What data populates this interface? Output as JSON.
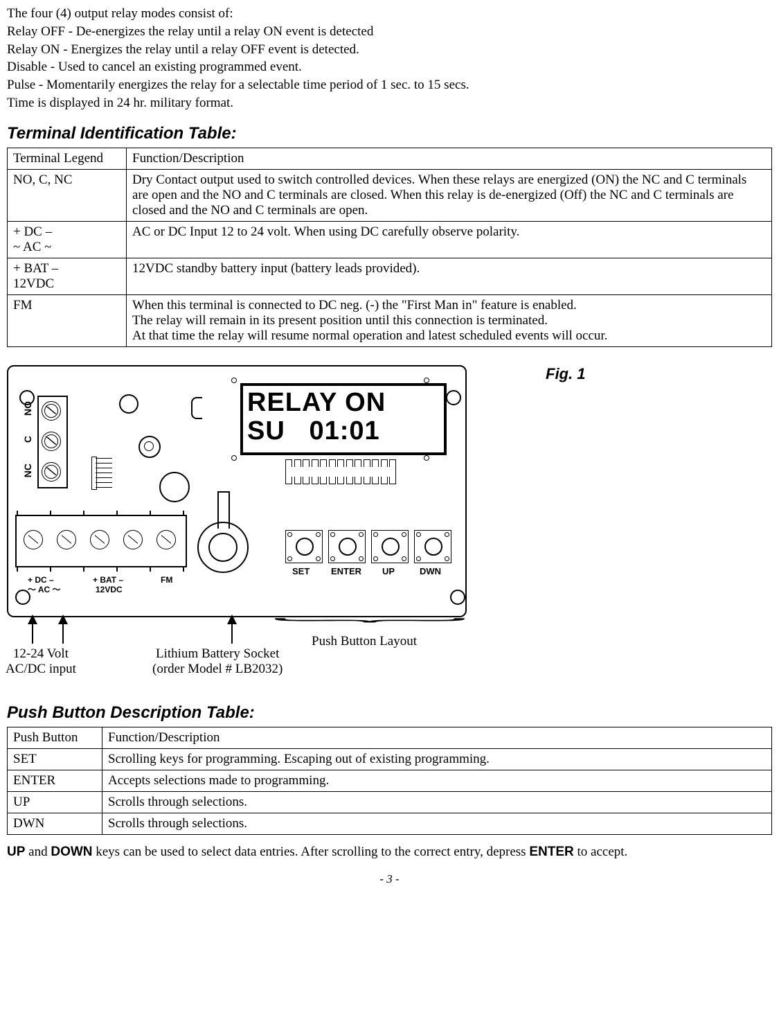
{
  "intro": {
    "line1": "The four (4) output relay modes consist of:",
    "line2": "Relay OFF - De-energizes the relay until a relay ON event is detected",
    "line3": "Relay ON - Energizes the relay until a relay OFF event is detected.",
    "line4": "Disable - Used to cancel an existing programmed event.",
    "line5": "Pulse - Momentarily energizes the relay for a selectable time period of 1 sec. to 15 secs.",
    "line6": "Time is displayed in 24 hr. military format."
  },
  "terminal_table": {
    "title": "Terminal Identification Table:",
    "header": {
      "c1": "Terminal Legend",
      "c2": "Function/Description"
    },
    "rows": [
      {
        "c1": "NO, C, NC",
        "c2": "Dry Contact output used to switch controlled devices. When these relays are energized (ON) the NC and C terminals are open and the NO and C terminals are closed. When this relay is de-energized (Off) the NC and C terminals are closed and the NO and C terminals are open."
      },
      {
        "c1": "+ DC –\n~ AC ~",
        "c2": "AC or DC Input 12 to 24 volt. When using DC carefully observe polarity."
      },
      {
        "c1": "+ BAT –\n12VDC",
        "c2": "12VDC standby battery input (battery leads provided)."
      },
      {
        "c1": "FM",
        "c2": "When this terminal is connected to DC neg. (-) the \"First Man in\" feature is enabled.\nThe relay will remain in its present position until this connection is terminated.\nAt that time the relay will resume normal operation and latest scheduled events will occur."
      }
    ]
  },
  "figure": {
    "label": "Fig. 1",
    "lcd_line1": "RELAY ON",
    "lcd_line2": "SU   01:01",
    "relay_terms": {
      "no": "NO",
      "c": "C",
      "nc": "NC"
    },
    "bottom_terms": {
      "dc": "+  DC  –",
      "ac": "～ AC ～",
      "bat": "+  BAT –",
      "bat2": "12VDC",
      "fm": "FM"
    },
    "buttons": {
      "set": "SET",
      "enter": "ENTER",
      "up": "UP",
      "dwn": "DWN"
    },
    "callouts": {
      "input": "12-24 Volt\nAC/DC input",
      "battery": "Lithium Battery Socket\n(order Model # LB2032)",
      "pushbtn": "Push Button Layout"
    }
  },
  "pushbutton_table": {
    "title": "Push Button Description Table:",
    "header": {
      "c1": "Push Button",
      "c2": "Function/Description"
    },
    "rows": [
      {
        "c1": "SET",
        "c2": "Scrolling keys for programming. Escaping out of existing programming."
      },
      {
        "c1": "ENTER",
        "c2": " Accepts selections made to programming."
      },
      {
        "c1": "UP",
        "c2": "Scrolls through selections."
      },
      {
        "c1": "DWN",
        "c2": "Scrolls through selections."
      }
    ]
  },
  "footnote": {
    "pre": "UP",
    "mid1": " and ",
    "down": "DOWN",
    "mid2": " keys can be used to select data entries. After scrolling to the correct entry, depress ",
    "enter": "ENTER",
    "post": " to accept."
  },
  "page_number": "- 3 -"
}
